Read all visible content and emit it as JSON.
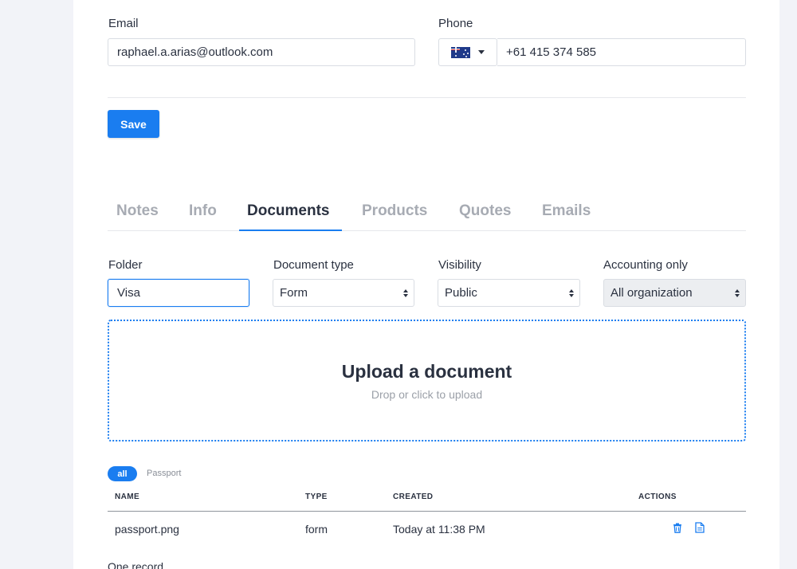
{
  "contact": {
    "email_label": "Email",
    "email_value": "raphael.a.arias@outlook.com",
    "phone_label": "Phone",
    "phone_country": "AU",
    "phone_value": "+61 415 374 585"
  },
  "actions": {
    "save_label": "Save"
  },
  "tabs": [
    {
      "label": "Notes",
      "active": false
    },
    {
      "label": "Info",
      "active": false
    },
    {
      "label": "Documents",
      "active": true
    },
    {
      "label": "Products",
      "active": false
    },
    {
      "label": "Quotes",
      "active": false
    },
    {
      "label": "Emails",
      "active": false
    }
  ],
  "documents": {
    "folder_label": "Folder",
    "folder_value": "Visa",
    "doctype_label": "Document type",
    "doctype_value": "Form",
    "visibility_label": "Visibility",
    "visibility_value": "Public",
    "accounting_label": "Accounting only",
    "accounting_value": "All organization",
    "upload_title": "Upload a document",
    "upload_subtitle": "Drop or click to upload",
    "filters": [
      {
        "label": "all",
        "active": true
      },
      {
        "label": "Passport",
        "active": false
      }
    ],
    "table": {
      "columns": [
        "NAME",
        "TYPE",
        "CREATED",
        "ACTIONS"
      ],
      "rows": [
        {
          "name": "passport.png",
          "type": "form",
          "created": "Today at 11:38 PM"
        }
      ]
    },
    "record_count": "One record"
  },
  "colors": {
    "accent": "#1a7df0",
    "text": "#2a3140",
    "muted": "#a7abb3",
    "page_bg": "#f2f3f8"
  },
  "icons": {
    "flag": "australia-flag-icon",
    "caret": "caret-down-icon",
    "delete": "trash-icon",
    "view": "document-icon"
  }
}
